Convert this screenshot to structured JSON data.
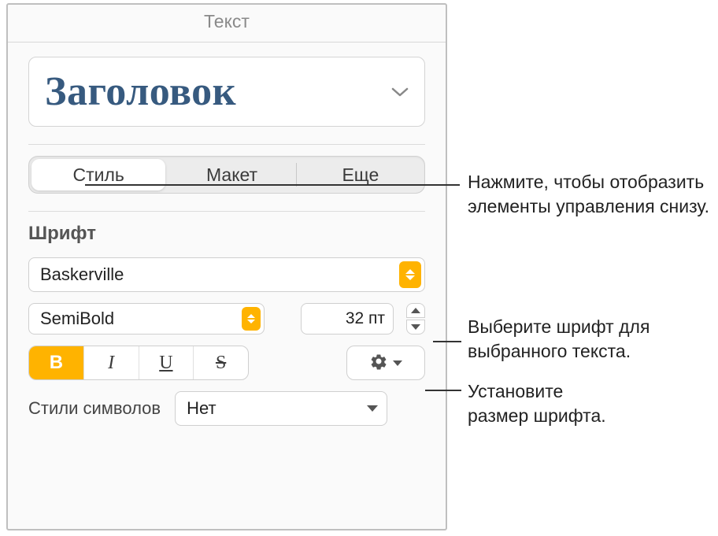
{
  "panel": {
    "title": "Текст"
  },
  "paragraph_style": {
    "name": "Заголовок"
  },
  "tabs": {
    "style": "Стиль",
    "layout": "Макет",
    "more": "Еще"
  },
  "font_section": {
    "title": "Шрифт"
  },
  "font": {
    "family": "Baskerville",
    "weight": "SemiBold",
    "size": "32 пт"
  },
  "style_buttons": {
    "bold": "B",
    "italic": "I",
    "underline": "U",
    "strike": "S"
  },
  "char_styles": {
    "label": "Стили символов",
    "value": "Нет"
  },
  "callouts": {
    "tabs": "Нажмите, чтобы отобразить элементы управления снизу.",
    "font": "Выберите шрифт для выбранного текста.",
    "size_l1": "Установите",
    "size_l2": "размер шрифта."
  }
}
